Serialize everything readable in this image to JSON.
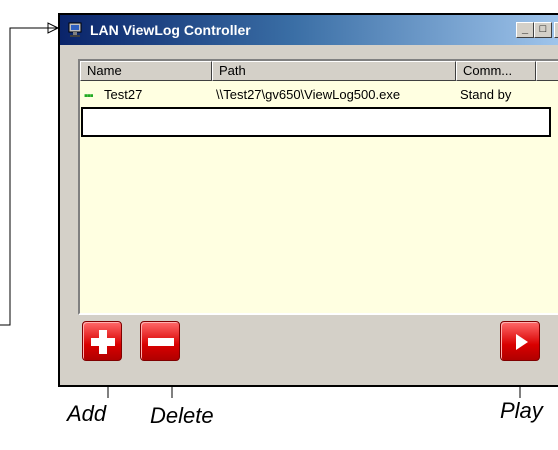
{
  "window": {
    "title": "LAN ViewLog Controller",
    "minimize_glyph": "_",
    "maximize_glyph": "□",
    "close_glyph": "×"
  },
  "listview": {
    "columns": [
      "Name",
      "Path",
      "Comm..."
    ],
    "rows": [
      {
        "status_icon": "green-dots-icon",
        "name": "Test27",
        "path": "\\\\Test27\\gv650\\ViewLog500.exe",
        "command": "Stand by"
      }
    ],
    "edit_value": ""
  },
  "buttons": {
    "add_icon": "plus-icon",
    "delete_icon": "minus-icon",
    "play_icon": "play-icon"
  },
  "callouts": {
    "add": "Add",
    "delete": "Delete",
    "play": "Play"
  },
  "colors": {
    "button_red": "#d90000",
    "list_background": "#ffffe1",
    "status_green": "#22aa22"
  }
}
